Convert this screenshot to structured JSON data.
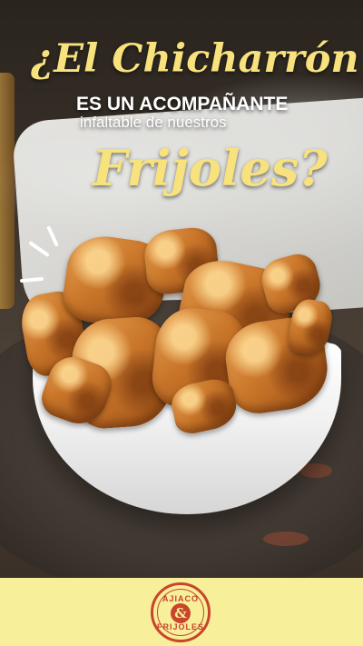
{
  "headline": {
    "line1": "¿El Chicharrón",
    "line2": "ES UN ACOMPAÑANTE",
    "line3": "infaltable de nuestros",
    "line4": "Frijoles?"
  },
  "logo": {
    "top_text": "AJIACO",
    "amp": "&",
    "bottom_text": "FRIJOLES"
  },
  "colors": {
    "accent_yellow": "#f7e27e",
    "footer_bg": "#f8ef9a",
    "logo_red": "#c8452c"
  }
}
